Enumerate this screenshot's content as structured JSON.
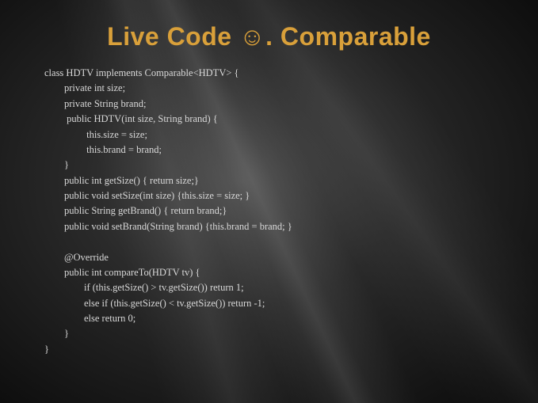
{
  "title_prefix": "Live Code ",
  "title_emoji": "☺",
  "title_suffix": ". Comparable",
  "code": "class HDTV implements Comparable<HDTV> {\n        private int size;\n        private String brand;\n         public HDTV(int size, String brand) {\n                 this.size = size;\n                 this.brand = brand;\n        }\n        public int getSize() { return size;}\n        public void setSize(int size) {this.size = size; }\n        public String getBrand() { return brand;}\n        public void setBrand(String brand) {this.brand = brand; }\n\n        @Override\n        public int compareTo(HDTV tv) {\n                if (this.getSize() > tv.getSize()) return 1;\n                else if (this.getSize() < tv.getSize()) return -1;\n                else return 0;\n        }\n}"
}
